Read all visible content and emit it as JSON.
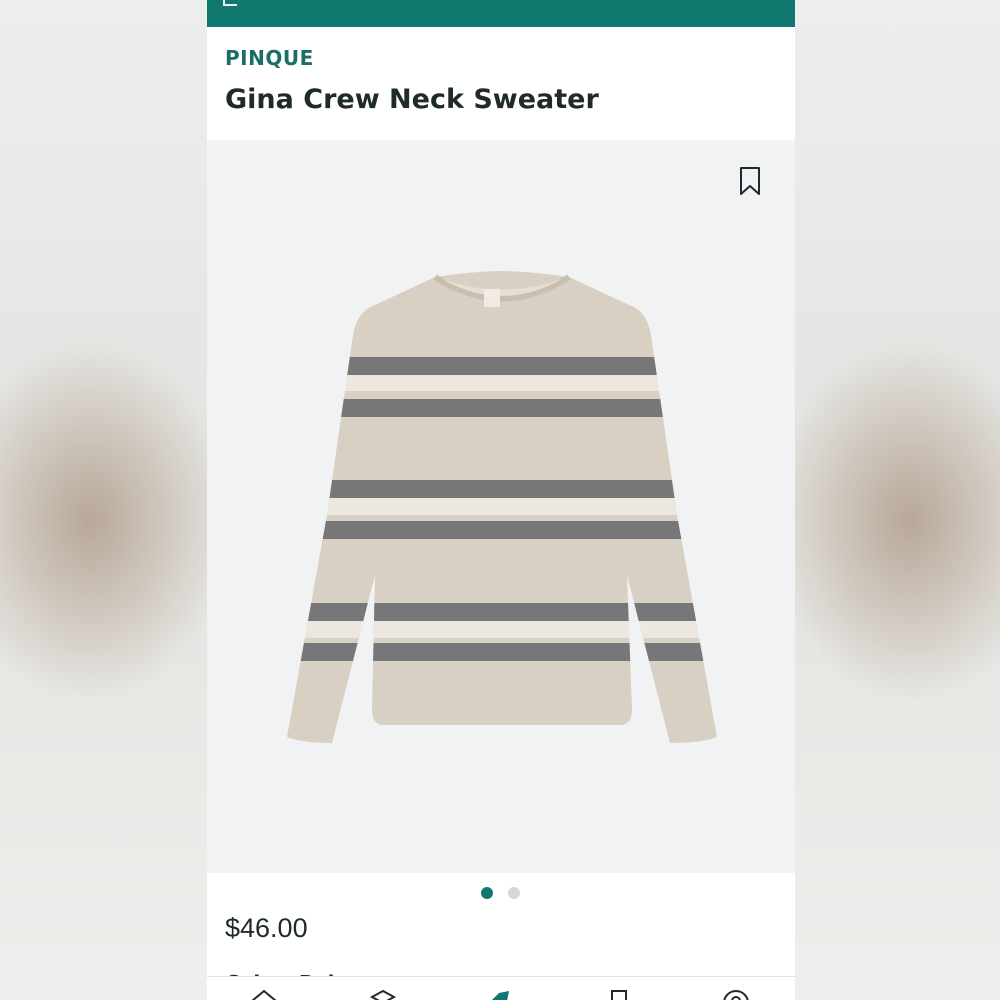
{
  "product": {
    "brand": "PINQUE",
    "name": "Gina Crew Neck Sweater",
    "price": "$46.00",
    "color_label": "Color: Bei",
    "image_count": 2,
    "active_image": 1
  },
  "icons": {
    "bookmark": "bookmark-icon",
    "tabs": [
      "home-icon",
      "box-icon",
      "tag-icon",
      "bookmark-icon",
      "account-icon"
    ]
  },
  "colors": {
    "accent": "#10786f",
    "brand_text": "#1a6e66",
    "text": "#1f2a2a",
    "image_bg": "#f1f2f4"
  }
}
